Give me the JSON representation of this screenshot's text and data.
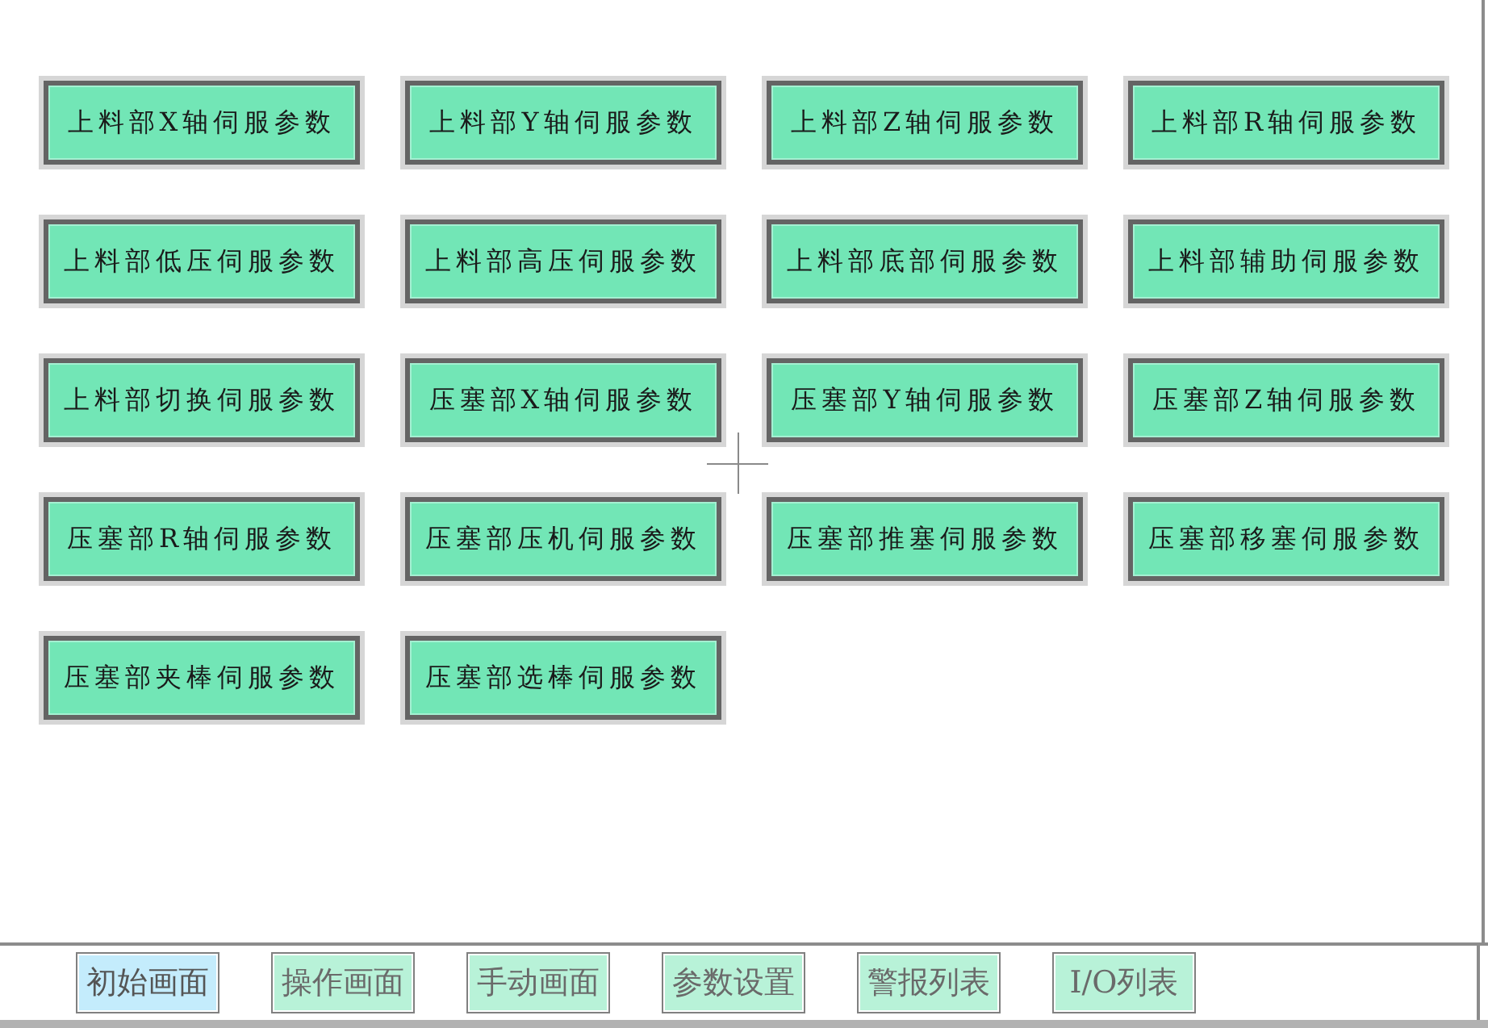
{
  "buttons": [
    {
      "label": "上料部X轴伺服参数"
    },
    {
      "label": "上料部Y轴伺服参数"
    },
    {
      "label": "上料部Z轴伺服参数"
    },
    {
      "label": "上料部R轴伺服参数"
    },
    {
      "label": "上料部低压伺服参数"
    },
    {
      "label": "上料部高压伺服参数"
    },
    {
      "label": "上料部底部伺服参数"
    },
    {
      "label": "上料部辅助伺服参数"
    },
    {
      "label": "上料部切换伺服参数"
    },
    {
      "label": "压塞部X轴伺服参数"
    },
    {
      "label": "压塞部Y轴伺服参数"
    },
    {
      "label": "压塞部Z轴伺服参数"
    },
    {
      "label": "压塞部R轴伺服参数"
    },
    {
      "label": "压塞部压机伺服参数"
    },
    {
      "label": "压塞部推塞伺服参数"
    },
    {
      "label": "压塞部移塞伺服参数"
    },
    {
      "label": "压塞部夹棒伺服参数"
    },
    {
      "label": "压塞部选棒伺服参数"
    }
  ],
  "nav": [
    {
      "label": "初始画面",
      "selected": true
    },
    {
      "label": "操作画面",
      "selected": false
    },
    {
      "label": "手动画面",
      "selected": false
    },
    {
      "label": "参数设置",
      "selected": false
    },
    {
      "label": "警报列表",
      "selected": false
    },
    {
      "label": "I/O列表",
      "selected": false
    }
  ]
}
